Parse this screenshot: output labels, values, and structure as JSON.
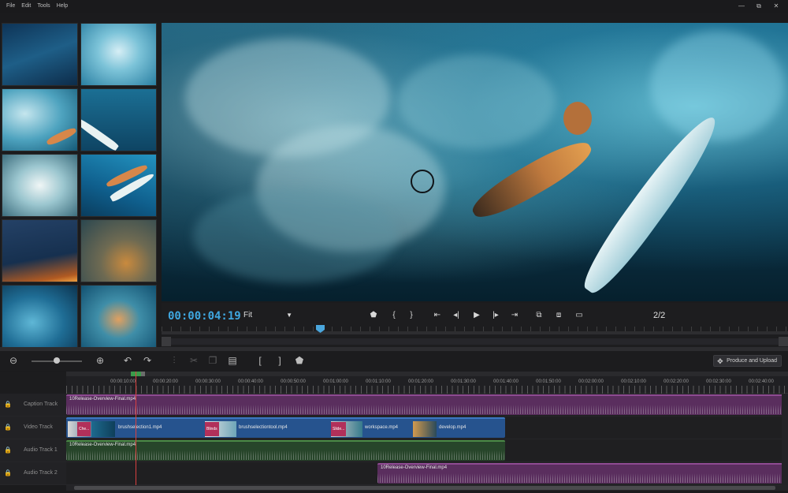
{
  "menu": [
    "File",
    "Edit",
    "Tools",
    "Help"
  ],
  "window_controls": [
    "—",
    "⧉",
    "✕"
  ],
  "preview": {
    "timecode": "00:00:04:19",
    "fit_value": "Fit",
    "page_indicator": "2/2",
    "controls": [
      "marker-icon",
      "mark-in-icon",
      "mark-out-icon",
      "go-start-icon",
      "prev-frame-icon",
      "play-icon",
      "next-frame-icon",
      "go-end-icon",
      "split-audio-icon",
      "snapshot-icon",
      "fullscreen-icon"
    ]
  },
  "toolbar": {
    "produce_label": "Produce and Upload"
  },
  "ruler_labels": [
    "00:00:10:00",
    "00:00:20:00",
    "00:00:30:00",
    "00:00:40:00",
    "00:00:50:00",
    "00:01:00:00",
    "00:01:10:00",
    "00:01:20:00",
    "00:01:30:00",
    "00:01:40:00",
    "00:01:50:00",
    "00:02:00:00",
    "00:02:10:00",
    "00:02:20:00",
    "00:02:30:00",
    "00:02:40:00"
  ],
  "tracks": {
    "caption": {
      "name": "Caption Track",
      "clip": "10Release-Overview-Final.mp4"
    },
    "video": {
      "name": "Video Track",
      "clips": [
        {
          "tag": "Che...",
          "name": "brushselection1.mp4"
        },
        {
          "tag": "Blinds",
          "name": "brushselectiontool.mp4"
        },
        {
          "tag": "Slide...",
          "name": "workspace.mp4"
        },
        {
          "tag": "",
          "name": "develop.mp4"
        }
      ]
    },
    "audio1": {
      "name": "Audio Track 1",
      "clip": "10Release-Overview-Final.mp4"
    },
    "audio2": {
      "name": "Audio Track 2",
      "clip": "10Release-Overview-Final.mp4"
    }
  },
  "colors": {
    "timecode": "#3fa7e0",
    "caption_clip": "#5a2e5e",
    "video_clip": "#26538e",
    "audio1_clip": "#27452a",
    "audio2_clip": "#5a2e5e",
    "playhead": "#d94040"
  }
}
